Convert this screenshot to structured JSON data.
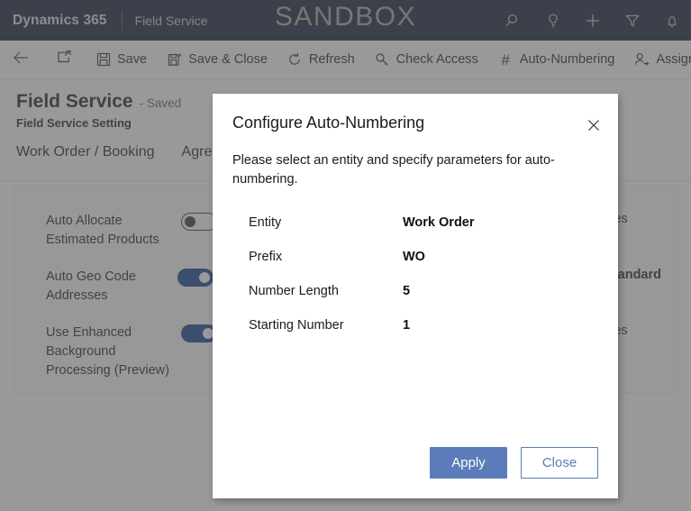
{
  "topbar": {
    "brand": "Dynamics 365",
    "app_name": "Field Service",
    "environment_banner": "SANDBOX",
    "icons": [
      {
        "name": "search-icon",
        "label": "Search"
      },
      {
        "name": "lightbulb-icon",
        "label": "Assistant"
      },
      {
        "name": "plus-icon",
        "label": "Quick create"
      },
      {
        "name": "filter-icon",
        "label": "Filter"
      },
      {
        "name": "bell-icon",
        "label": "Notifications"
      }
    ]
  },
  "commandbar": {
    "back_label": "",
    "popout_label": "",
    "buttons": [
      {
        "name": "save-button",
        "label": "Save",
        "icon": "save-icon"
      },
      {
        "name": "save-and-close-button",
        "label": "Save & Close",
        "icon": "save-close-icon"
      },
      {
        "name": "refresh-button",
        "label": "Refresh",
        "icon": "refresh-icon"
      },
      {
        "name": "check-access-button",
        "label": "Check Access",
        "icon": "key-icon"
      },
      {
        "name": "auto-numbering-button",
        "label": "Auto-Numbering",
        "icon": "hash-icon"
      },
      {
        "name": "assign-button",
        "label": "Assign",
        "icon": "assign-person-icon"
      }
    ]
  },
  "record": {
    "title": "Field Service",
    "saved_state": "- Saved",
    "subtitle": "Field Service Setting"
  },
  "tabs": [
    {
      "label": "Work Order / Booking"
    },
    {
      "label": "Agree"
    }
  ],
  "settings": [
    {
      "label": "Auto Allocate Estimated Products",
      "toggle": "off",
      "value": "Yes"
    },
    {
      "label": "Auto Geo Code Addresses",
      "toggle": "on",
      "value": "/Standard"
    },
    {
      "label": "Use Enhanced Background Processing (Preview)",
      "toggle": "on",
      "value": "Yes"
    }
  ],
  "dialog": {
    "title": "Configure Auto-Numbering",
    "close_icon": "close-icon",
    "description": "Please select an entity and specify parameters for auto-numbering.",
    "fields": [
      {
        "label": "Entity",
        "value": "Work Order"
      },
      {
        "label": "Prefix",
        "value": "WO"
      },
      {
        "label": "Number Length",
        "value": "5"
      },
      {
        "label": "Starting Number",
        "value": "1"
      }
    ],
    "apply_label": "Apply",
    "close_label": "Close"
  },
  "colors": {
    "topbar_bg": "#0c1733",
    "sandbox_text": "#a9a39a",
    "primary_button": "#5b7cb8",
    "toggle_on": "#0b3b8c",
    "overlay": "rgba(90,90,90,0.62)"
  }
}
